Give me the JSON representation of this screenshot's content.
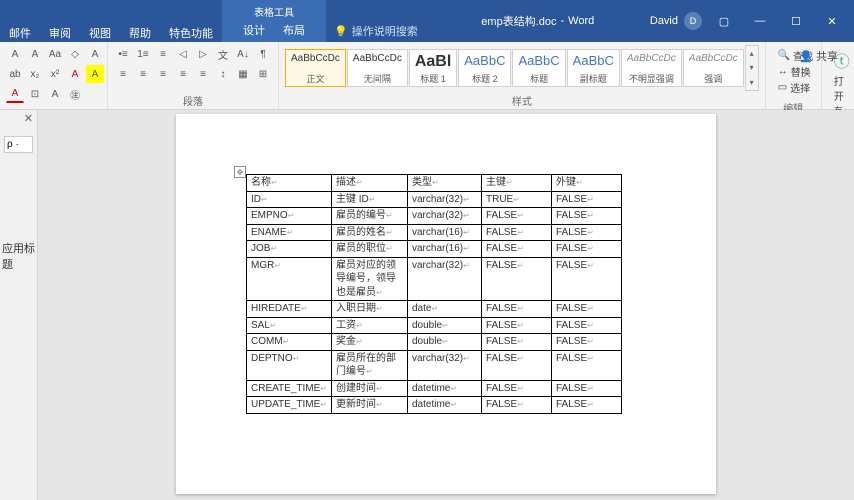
{
  "title": {
    "context_label": "表格工具",
    "context_sub": [
      "设计",
      "布局"
    ],
    "filename": "emp表结构.doc",
    "app": "Word",
    "user": "David",
    "share": "共享"
  },
  "tabs": [
    "邮件",
    "审阅",
    "视图",
    "帮助",
    "特色功能"
  ],
  "tellme": "操作说明搜索",
  "ribbon": {
    "group_paragraph": "段落",
    "group_styles": "样式",
    "group_edit": "编辑",
    "group_translate": "有道翻译",
    "styles": [
      {
        "preview": "AaBbCcDc",
        "name": "正文",
        "sel": true
      },
      {
        "preview": "AaBbCcDc",
        "name": "无间隔"
      },
      {
        "preview": "AaBl",
        "name": "标题 1"
      },
      {
        "preview": "AaBbC",
        "name": "标题 2"
      },
      {
        "preview": "AaBbC",
        "name": "标题"
      },
      {
        "preview": "AaBbC",
        "name": "副标题"
      },
      {
        "preview": "AaBbCcDc",
        "name": "不明显强调"
      },
      {
        "preview": "AaBbCcDc",
        "name": "强调"
      }
    ],
    "edit_items": [
      "查找",
      "替换",
      "选择"
    ],
    "translate_items": [
      "打开",
      "有道翻译"
    ]
  },
  "nav": {
    "heading_label": "应用标题",
    "search_ph": ""
  },
  "table": {
    "headers": [
      "名称",
      "描述",
      "类型",
      "主键",
      "外键"
    ],
    "rows": [
      [
        "ID",
        "主键 ID",
        "varchar(32)",
        "TRUE",
        "FALSE"
      ],
      [
        "EMPNO",
        "雇员的编号",
        "varchar(32)",
        "FALSE",
        "FALSE"
      ],
      [
        "ENAME",
        "雇员的姓名",
        "varchar(16)",
        "FALSE",
        "FALSE"
      ],
      [
        "JOB",
        "雇员的职位",
        "varchar(16)",
        "FALSE",
        "FALSE"
      ],
      [
        "MGR",
        "雇员对应的领导编号，领导也是雇员",
        "varchar(32)",
        "FALSE",
        "FALSE"
      ],
      [
        "HIREDATE",
        "入职日期",
        "date",
        "FALSE",
        "FALSE"
      ],
      [
        "SAL",
        "工资",
        "double",
        "FALSE",
        "FALSE"
      ],
      [
        "COMM",
        "奖金",
        "double",
        "FALSE",
        "FALSE"
      ],
      [
        "DEPTNO",
        "雇员所在的部门编号",
        "varchar(32)",
        "FALSE",
        "FALSE"
      ],
      [
        "CREATE_TIME",
        "创建时间",
        "datetime",
        "FALSE",
        "FALSE"
      ],
      [
        "UPDATE_TIME",
        "更新时间",
        "datetime",
        "FALSE",
        "FALSE"
      ]
    ]
  }
}
